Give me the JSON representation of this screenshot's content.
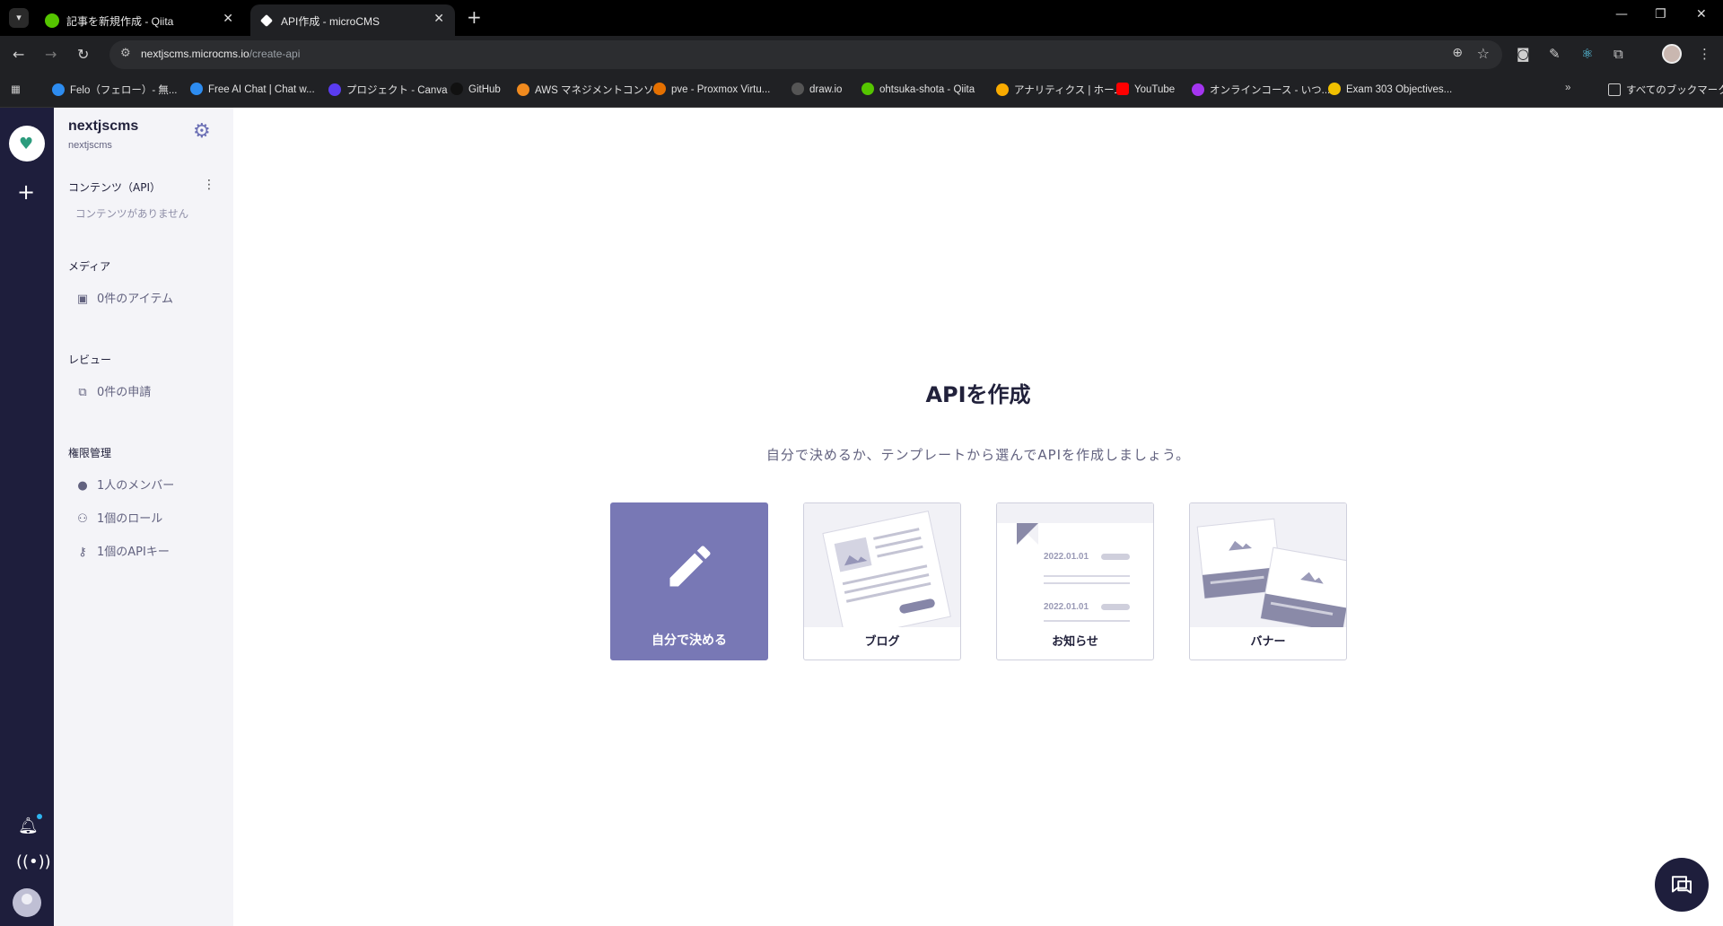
{
  "browser": {
    "tabs": [
      {
        "title": "記事を新規作成 - Qiita",
        "favicon_color": "#55c500"
      },
      {
        "title": "API作成 - microCMS",
        "favicon_color": "#ffffff"
      }
    ],
    "url_host": "nextjscms.microcms.io",
    "url_path": "/create-api",
    "bookmarks": [
      {
        "label": "Felo（フェロー）- 無...",
        "color": "#2d8cf0"
      },
      {
        "label": "Free AI Chat | Chat w...",
        "color": "#2d8cf0"
      },
      {
        "label": "プロジェクト - Canva",
        "color": "#5a3cf0"
      },
      {
        "label": "GitHub",
        "color": "#000000"
      },
      {
        "label": "AWS マネジメントコンソ...",
        "color": "#f08a1e"
      },
      {
        "label": "pve - Proxmox Virtu...",
        "color": "#e57000"
      },
      {
        "label": "draw.io",
        "color": "#555555"
      },
      {
        "label": "ohtsuka-shota - Qiita",
        "color": "#55c500"
      },
      {
        "label": "アナリティクス | ホーム",
        "color": "#f9ab00"
      },
      {
        "label": "YouTube",
        "color": "#ff0000"
      },
      {
        "label": "オンラインコース - いつ...",
        "color": "#a435f0"
      },
      {
        "label": "Exam 303 Objectives...",
        "color": "#f0c000"
      }
    ],
    "all_bookmarks": "すべてのブックマーク"
  },
  "sidebar": {
    "service_name": "nextjscms",
    "service_id": "nextjscms",
    "contents_title": "コンテンツ（API）",
    "contents_empty": "コンテンツがありません",
    "media_title": "メディア",
    "media_item": "0件のアイテム",
    "review_title": "レビュー",
    "review_item": "0件の申請",
    "permissions_title": "権限管理",
    "members_item": "1人のメンバー",
    "roles_item": "1個のロール",
    "apikeys_item": "1個のAPIキー"
  },
  "main": {
    "title": "APIを作成",
    "subtitle": "自分で決めるか、テンプレートから選んでAPIを作成しましょう。",
    "cards": {
      "custom": "自分で決める",
      "blog": "ブログ",
      "news": "お知らせ",
      "banner": "バナー"
    },
    "news_dates": [
      "2022.01.01",
      "2022.01.01"
    ]
  },
  "colors": {
    "rail": "#1e1e3c",
    "accent": "#7878b5",
    "sidebar_bg": "#f4f4f8"
  }
}
